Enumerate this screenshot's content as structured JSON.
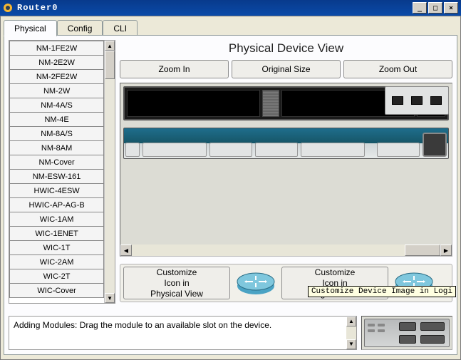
{
  "window": {
    "title": "Router0"
  },
  "tabs": {
    "physical": "Physical",
    "config": "Config",
    "cli": "CLI"
  },
  "physical": {
    "title": "Physical Device View",
    "zoom_in": "Zoom In",
    "zoom_orig": "Original Size",
    "zoom_out": "Zoom Out",
    "customize_physical": "Customize\nIcon in\nPhysical View",
    "customize_logical": "Customize\nIcon in\nLogical View"
  },
  "modules": [
    "NM-1FE2W",
    "NM-2E2W",
    "NM-2FE2W",
    "NM-2W",
    "NM-4A/S",
    "NM-4E",
    "NM-8A/S",
    "NM-8AM",
    "NM-Cover",
    "NM-ESW-161",
    "HWIC-4ESW",
    "HWIC-AP-AG-B",
    "WIC-1AM",
    "WIC-1ENET",
    "WIC-1T",
    "WIC-2AM",
    "WIC-2T",
    "WIC-Cover"
  ],
  "description": "Adding Modules: Drag the module to an available slot on the device.",
  "tooltip": "Customize Device Image in Logi"
}
